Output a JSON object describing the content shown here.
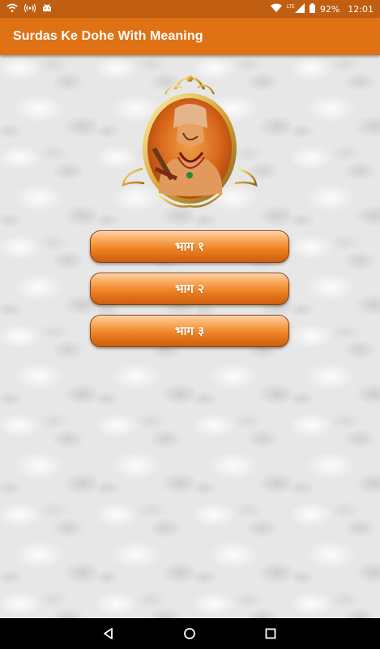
{
  "status_bar": {
    "battery_percent": "92%",
    "time": "12:01",
    "network_label": "LTE",
    "icons": [
      "wifi-icon",
      "hotspot-icon",
      "android-icon",
      "signal-icon",
      "battery-icon"
    ]
  },
  "app_bar": {
    "title": "Surdas Ke Dohe With Meaning"
  },
  "menu": {
    "buttons": [
      {
        "label": "भाग १"
      },
      {
        "label": "भाग २"
      },
      {
        "label": "भाग ३"
      }
    ]
  },
  "nav_bar": {
    "icons": [
      "back-icon",
      "home-icon",
      "recents-icon"
    ]
  },
  "colors": {
    "status_bar": "#c05f12",
    "app_bar": "#df7215",
    "button_accent": "#eb7d1f"
  }
}
